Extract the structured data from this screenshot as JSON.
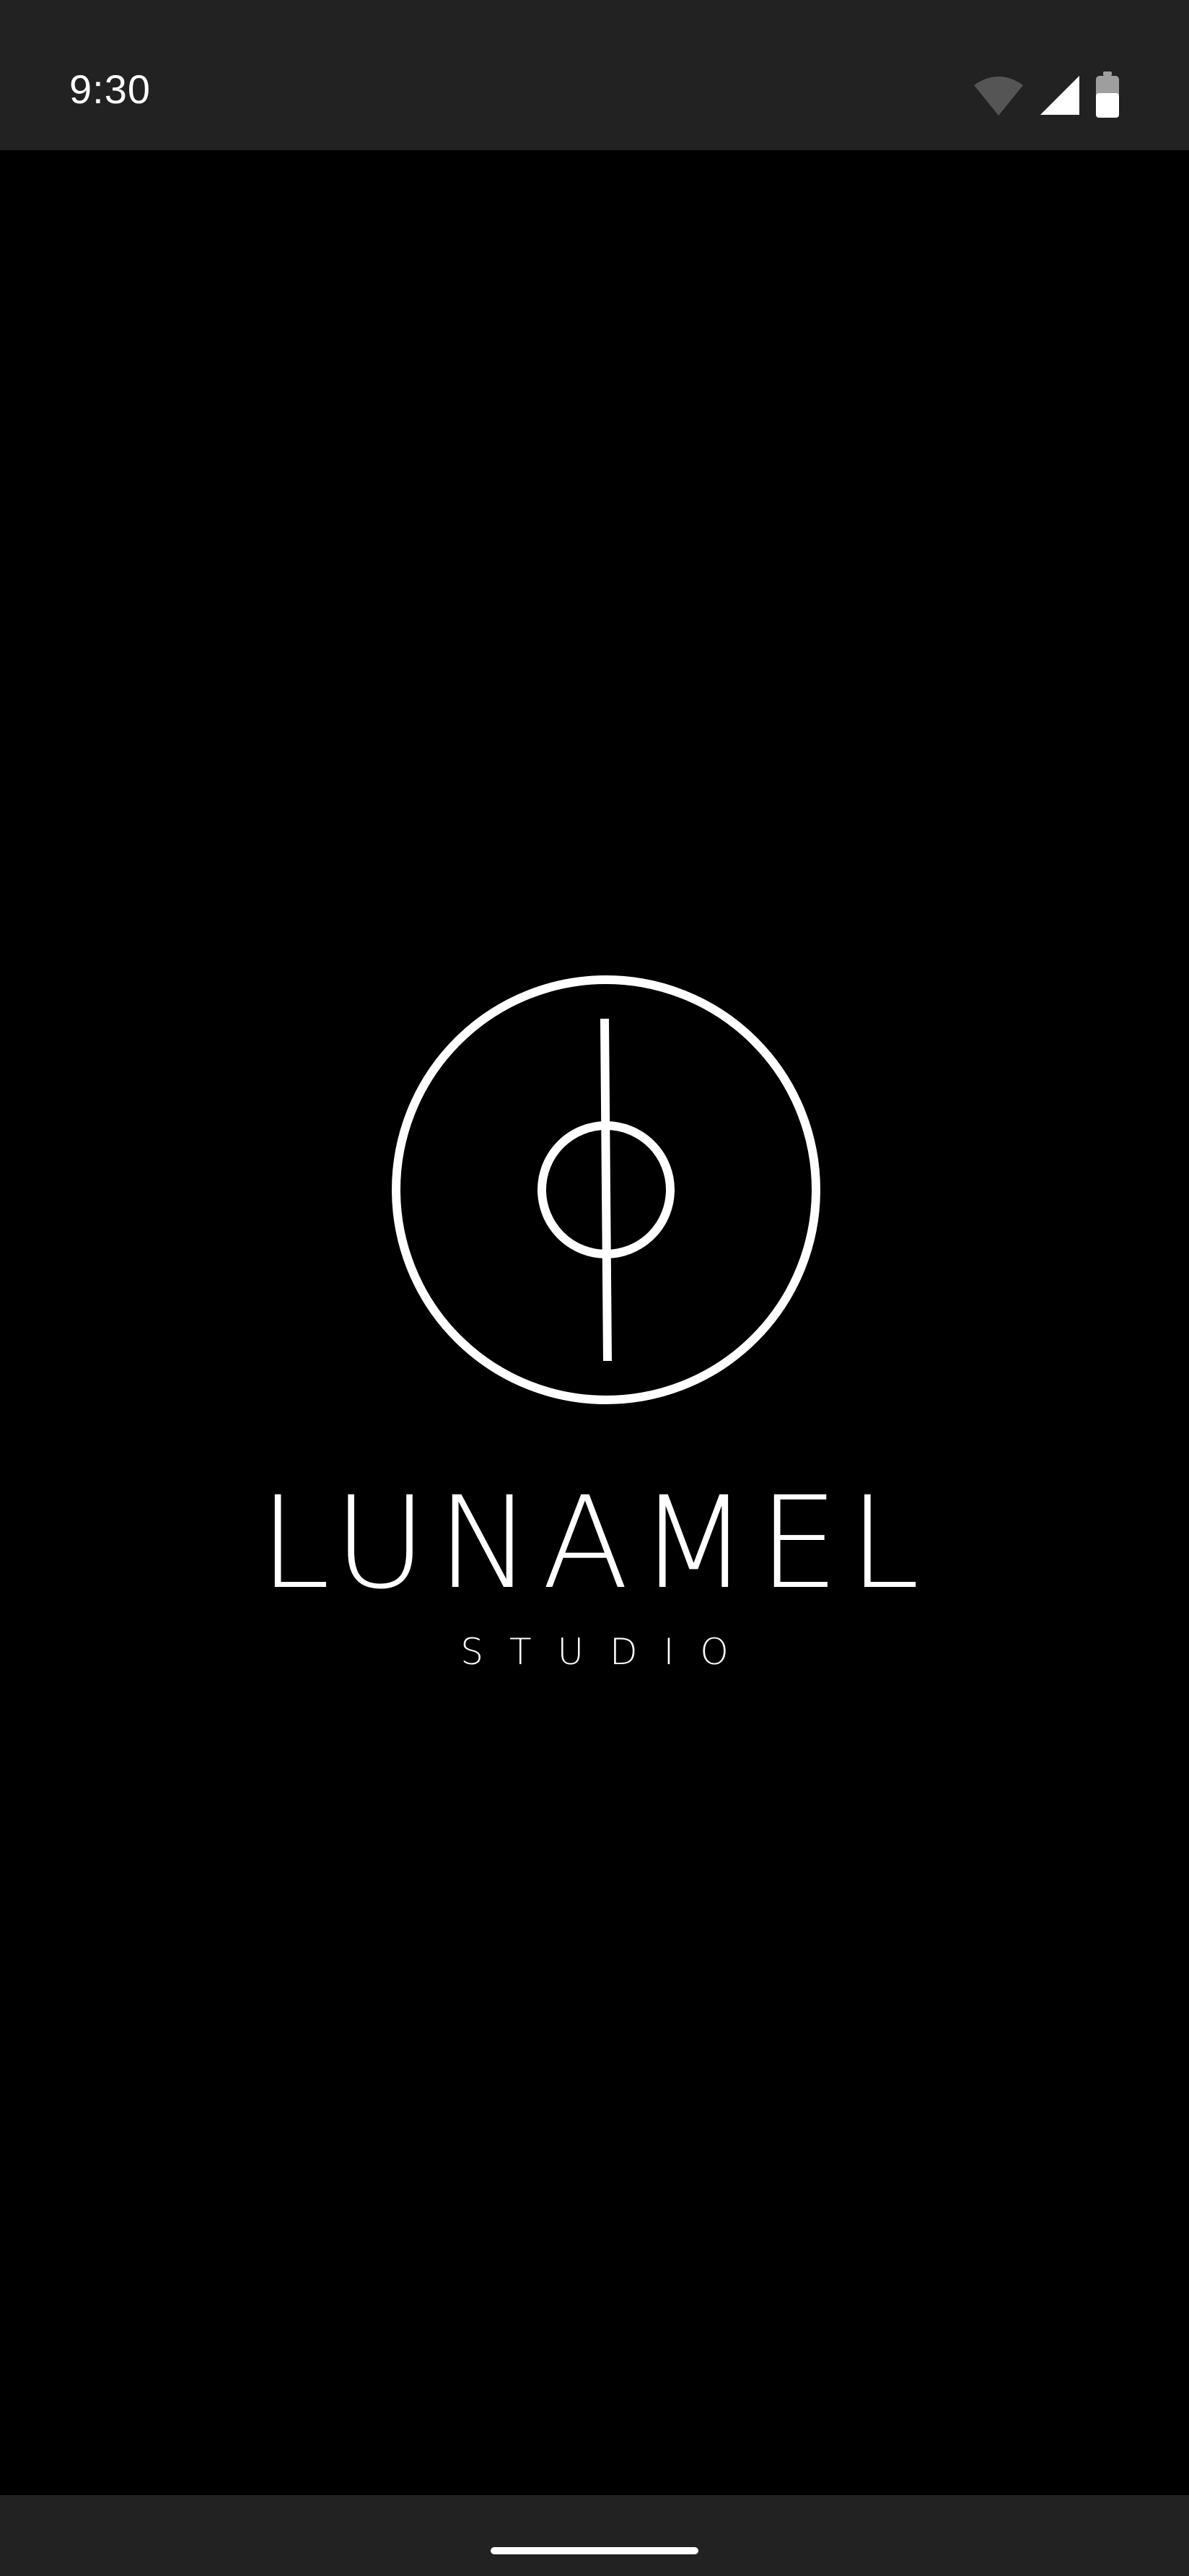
{
  "status_bar": {
    "time": "9:30",
    "icons": [
      "wifi-icon",
      "cellular-signal-icon",
      "battery-icon"
    ],
    "background": "#222222"
  },
  "splash": {
    "background": "#000000",
    "logo_icon": "lunamel-logo-icon",
    "brand_name": "LUNAMEL",
    "brand_subtitle": "STUDIO",
    "foreground": "#ffffff"
  },
  "nav_bar": {
    "background": "#222222",
    "handle": "home-gesture-handle"
  }
}
